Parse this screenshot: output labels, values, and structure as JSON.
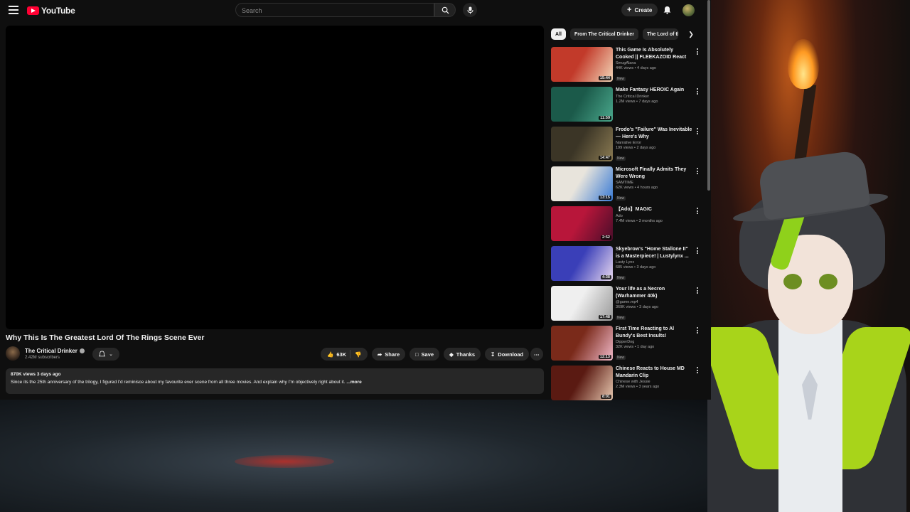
{
  "header": {
    "logo_text": "YouTube",
    "search_placeholder": "Search",
    "create_label": "Create"
  },
  "video": {
    "title": "Why This Is The Greatest Lord Of The Rings Scene Ever",
    "channel": "The Critical Drinker",
    "subscribers": "2.42M subscribers",
    "likes": "63K",
    "share_label": "Share",
    "save_label": "Save",
    "thanks_label": "Thanks",
    "download_label": "Download",
    "views_age": "870K views  3 days ago",
    "description": "Since its the 25th anniversary of the trilogy, I figured I'd reminisce about my favourite ever scene from all three movies. And explain why I'm objectively right about it.",
    "more_label": "...more"
  },
  "chips": [
    "All",
    "From The Critical Drinker",
    "The Lord of the Rings"
  ],
  "recommendations": [
    {
      "title": "This Game Is Absolutely Cooked || FLEEKAZOID React",
      "channel": "SmugAlana",
      "meta": "44K views • 4 days ago",
      "badge": "New",
      "duration": "15:44",
      "thumb_a": "#c23a2a",
      "thumb_b": "#f3d6b8"
    },
    {
      "title": "Make Fantasy HEROIC Again",
      "channel": "The Critical Drinker",
      "meta": "1.2M views • 7 days ago",
      "badge": "",
      "duration": "11:59",
      "thumb_a": "#1b5a4a",
      "thumb_b": "#4aa88c"
    },
    {
      "title": "Frodo's \"Failure\" Was Inevitable — Here's Why",
      "channel": "Narrative Error",
      "meta": "199 views • 2 days ago",
      "badge": "New",
      "duration": "14:47",
      "thumb_a": "#3b3526",
      "thumb_b": "#8a7a52"
    },
    {
      "title": "Microsoft Finally Admits They Were Wrong",
      "channel": "SAMTIME",
      "meta": "62K views • 4 hours ago",
      "badge": "New",
      "duration": "13:15",
      "thumb_a": "#e8e4dc",
      "thumb_b": "#3a7bd5"
    },
    {
      "title": "【Ado】MAGIC",
      "channel": "Ado",
      "meta": "7.4M views • 3 months ago",
      "badge": "",
      "duration": "2:52",
      "thumb_a": "#b8163a",
      "thumb_b": "#4a0d2a"
    },
    {
      "title": "Skyebrow's \"Home Stallone II\" is a Masterpiece! | Lustylynx ...",
      "channel": "Lusty Lynx",
      "meta": "685 views • 3 days ago",
      "badge": "New",
      "duration": "4:38",
      "thumb_a": "#3a3fb8",
      "thumb_b": "#e8d8f0"
    },
    {
      "title": "Your life as a Necron (Warhammer 40k)",
      "channel": "@game.mp4",
      "meta": "369K views • 3 days ago",
      "badge": "New",
      "duration": "17:48",
      "thumb_a": "#efefef",
      "thumb_b": "#9a9a9a"
    },
    {
      "title": "First Time Reacting to Al Bundy's Best Insults!",
      "channel": "DipperDog",
      "meta": "32K views • 1 day ago",
      "badge": "New",
      "duration": "12:13",
      "thumb_a": "#7a2a1a",
      "thumb_b": "#f0b8c8"
    },
    {
      "title": "Chinese Reacts to House MD Mandarin Clip",
      "channel": "Chinese with Jessie",
      "meta": "2.3M views • 3 years ago",
      "badge": "",
      "duration": "8:01",
      "thumb_a": "#5a1a12",
      "thumb_b": "#e8c8b0"
    }
  ]
}
